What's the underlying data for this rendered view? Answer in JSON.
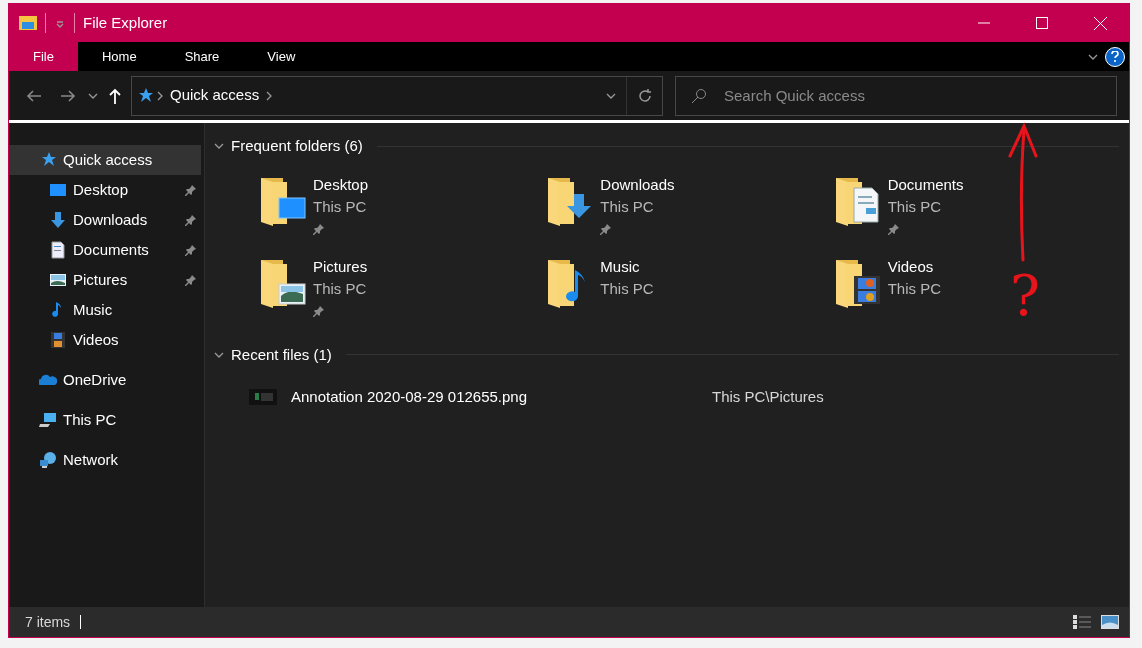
{
  "window": {
    "title": "File Explorer"
  },
  "ribbon": {
    "tabs": [
      {
        "label": "File",
        "selected": true
      },
      {
        "label": "Home",
        "selected": false
      },
      {
        "label": "Share",
        "selected": false
      },
      {
        "label": "View",
        "selected": false
      }
    ]
  },
  "address_bar": {
    "path": [
      "Quick access"
    ]
  },
  "search": {
    "placeholder": "Search Quick access"
  },
  "sidebar": {
    "items": [
      {
        "label": "Quick access",
        "selected": true,
        "pinned": false,
        "children": [
          {
            "label": "Desktop",
            "selected": false,
            "pinned": true
          },
          {
            "label": "Downloads",
            "selected": false,
            "pinned": true
          },
          {
            "label": "Documents",
            "selected": false,
            "pinned": true
          },
          {
            "label": "Pictures",
            "selected": false,
            "pinned": true
          },
          {
            "label": "Music",
            "selected": false,
            "pinned": false
          },
          {
            "label": "Videos",
            "selected": false,
            "pinned": false
          }
        ]
      },
      {
        "label": "OneDrive",
        "selected": false,
        "pinned": false
      },
      {
        "label": "This PC",
        "selected": false,
        "pinned": false
      },
      {
        "label": "Network",
        "selected": false,
        "pinned": false
      }
    ]
  },
  "frequent_folders": {
    "heading": "Frequent folders (6)",
    "expanded": true,
    "items": [
      {
        "name": "Desktop",
        "location": "This PC",
        "pinned": true
      },
      {
        "name": "Downloads",
        "location": "This PC",
        "pinned": true
      },
      {
        "name": "Documents",
        "location": "This PC",
        "pinned": true
      },
      {
        "name": "Pictures",
        "location": "This PC",
        "pinned": true
      },
      {
        "name": "Music",
        "location": "This PC",
        "pinned": false
      },
      {
        "name": "Videos",
        "location": "This PC",
        "pinned": false
      }
    ]
  },
  "recent_files": {
    "heading": "Recent files (1)",
    "expanded": true,
    "items": [
      {
        "name": "Annotation 2020-08-29 012655.png",
        "location": "This PC\\Pictures"
      }
    ]
  },
  "status_bar": {
    "count": "7 items"
  },
  "annotation": {
    "mark": "?"
  }
}
